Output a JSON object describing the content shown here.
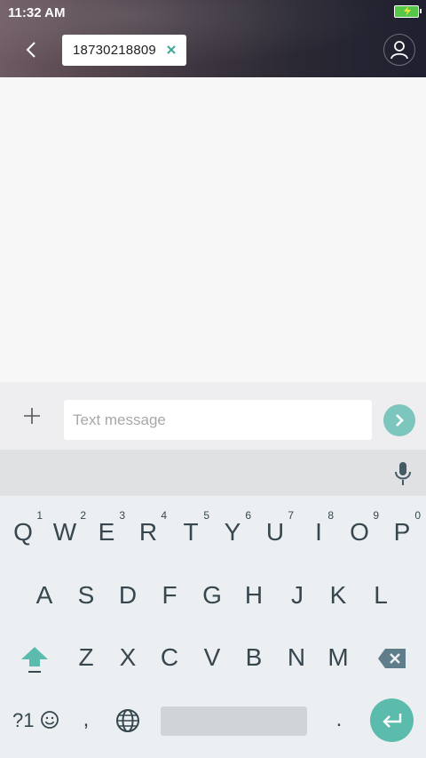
{
  "status_bar": {
    "time": "11:32 AM"
  },
  "header": {
    "recipient_number": "18730218809"
  },
  "compose": {
    "placeholder": "Text message"
  },
  "keyboard": {
    "row1": [
      {
        "key": "Q",
        "hint": "1"
      },
      {
        "key": "W",
        "hint": "2"
      },
      {
        "key": "E",
        "hint": "3"
      },
      {
        "key": "R",
        "hint": "4"
      },
      {
        "key": "T",
        "hint": "5"
      },
      {
        "key": "Y",
        "hint": "6"
      },
      {
        "key": "U",
        "hint": "7"
      },
      {
        "key": "I",
        "hint": "8"
      },
      {
        "key": "O",
        "hint": "9"
      },
      {
        "key": "P",
        "hint": "0"
      }
    ],
    "row2": [
      "A",
      "S",
      "D",
      "F",
      "G",
      "H",
      "J",
      "K",
      "L"
    ],
    "row3": [
      "Z",
      "X",
      "C",
      "V",
      "B",
      "N",
      "M"
    ],
    "symbols_label": "?1",
    "comma": ",",
    "period": "."
  },
  "colors": {
    "accent": "#5bbcae",
    "send": "#7cc6bd",
    "key_text": "#37474f"
  },
  "icons": [
    "back-arrow-icon",
    "close-icon",
    "contact-icon",
    "plus-icon",
    "send-icon",
    "mic-icon",
    "shift-icon",
    "backspace-icon",
    "emoji-icon",
    "globe-icon",
    "enter-icon",
    "battery-icon"
  ]
}
